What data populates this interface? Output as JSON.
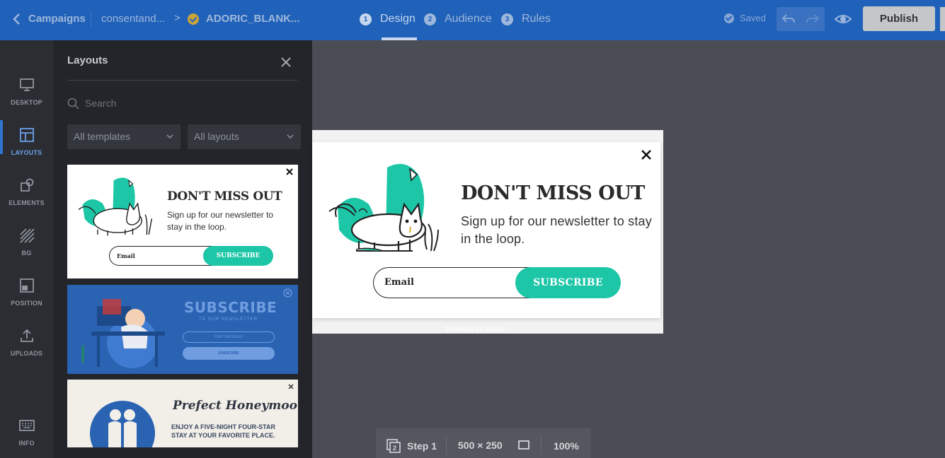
{
  "header": {
    "back_label": "Campaigns",
    "breadcrumb_1": "consentand...",
    "campaign_name": "ADORIC_BLANK...",
    "steps": [
      {
        "num": "1",
        "label": "Design"
      },
      {
        "num": "2",
        "label": "Audience"
      },
      {
        "num": "3",
        "label": "Rules"
      }
    ],
    "saved_label": "Saved",
    "publish_label": "Publish"
  },
  "rail": {
    "items": [
      {
        "label": "DESKTOP"
      },
      {
        "label": "LAYOUTS"
      },
      {
        "label": "ELEMENTS"
      },
      {
        "label": "BG"
      },
      {
        "label": "POSITION"
      },
      {
        "label": "UPLOADS"
      },
      {
        "label": "INFO"
      }
    ]
  },
  "panel": {
    "title": "Layouts",
    "search_placeholder": "Search",
    "filter_templates": "All templates",
    "filter_layouts": "All layouts",
    "templates": [
      {
        "heading": "DON'T MISS OUT",
        "sub": "Sign up for our newsletter to stay in the loop.",
        "field": "Email",
        "button": "SUBSCRIBE"
      },
      {
        "heading": "SUBSCRIBE",
        "sub": "TO OUR NEWSLETTER",
        "field": "FOR THE DEALS",
        "button": "SUBSCRIBE"
      },
      {
        "heading": "Prefect Honeymoon!",
        "sub": "ENJOY A FIVE-NIGHT FOUR-STAR STAY AT YOUR FAVORITE PLACE."
      }
    ]
  },
  "popup": {
    "heading": "DON'T MISS OUT",
    "subtext": "Sign up for our newsletter to stay in the loop.",
    "email_placeholder": "Email",
    "button_label": "SUBSCRIBE",
    "powered_by": "Powered by Adoric"
  },
  "bottombar": {
    "step_label": "Step 1",
    "size_label": "500 × 250",
    "zoom_label": "100%"
  },
  "colors": {
    "topbar": "#2061b9",
    "accent": "#1cc6a6",
    "canvas_bg": "#4b4d55",
    "panel_bg": "#23252b"
  }
}
